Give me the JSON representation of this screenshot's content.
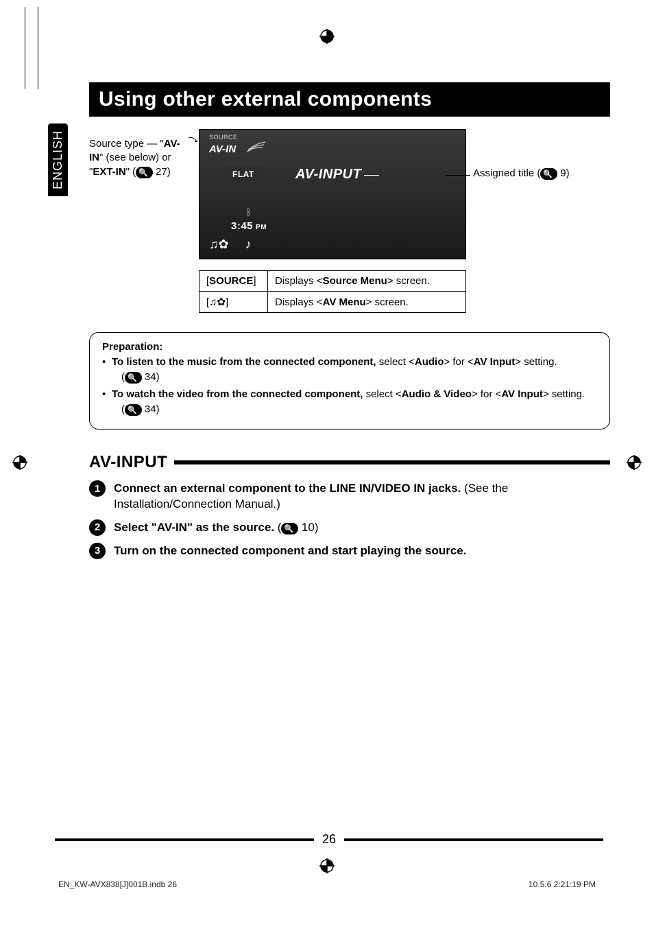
{
  "side_tab": "ENGLISH",
  "title": "Using other external components",
  "source_note": {
    "prefix": "Source type — \"",
    "avin": "AV-IN",
    "mid": "\" (see below) or \"",
    "extin": "EXT-IN",
    "suffix": "\" (",
    "ref": "27",
    "close": ")"
  },
  "screen": {
    "source_btn": "SOURCE",
    "source_label": "AV-IN",
    "flat": "FLAT",
    "center": "AV-INPUT",
    "time": "3:45",
    "ampm": "PM",
    "bt_glyph": "ᛒ",
    "note_gear": "♫✿",
    "note_icons": "♪"
  },
  "assigned_title": {
    "label": "Assigned title (",
    "ref": "9",
    "close": ")"
  },
  "btn_table": {
    "r1_label": "[SOURCE]",
    "r1_text_a": "Displays <",
    "r1_text_b": "Source Menu",
    "r1_text_c": "> screen.",
    "r2_icons": "[♫✿]",
    "r2_text_a": "Displays <",
    "r2_text_b": "AV Menu",
    "r2_text_c": "> screen."
  },
  "prep": {
    "header": "Preparation:",
    "li1_a": "To listen to the music from the connected component, ",
    "li1_b": "select <",
    "li1_c": "Audio",
    "li1_d": "> for <",
    "li1_e": "AV Input",
    "li1_f": "> setting.",
    "li1_ref": "34",
    "li2_a": "To watch the video from the connected component, ",
    "li2_b": "select <",
    "li2_c": "Audio & Video",
    "li2_d": "> for <",
    "li2_e": "AV Input",
    "li2_f": "> setting.",
    "li2_ref": "34"
  },
  "section_head": "AV-INPUT",
  "steps": {
    "s1_num": "!",
    "s1_a": "Connect an external component to the LINE IN/VIDEO IN jacks. ",
    "s1_b": "(See the Installation/Connection Manual.)",
    "s2_num": "⁄",
    "s2_a": "Select \"AV-IN\" as the source. ",
    "s2_b": "(",
    "s2_ref": "10",
    "s2_c": ")",
    "s3_num": "Ÿ",
    "s3_a": "Turn on the connected component and start playing the source."
  },
  "page_number": "26",
  "imprint_left": "EN_KW-AVX838[J]001B.indb   26",
  "imprint_right": "10.5.6   2:21:19 PM"
}
